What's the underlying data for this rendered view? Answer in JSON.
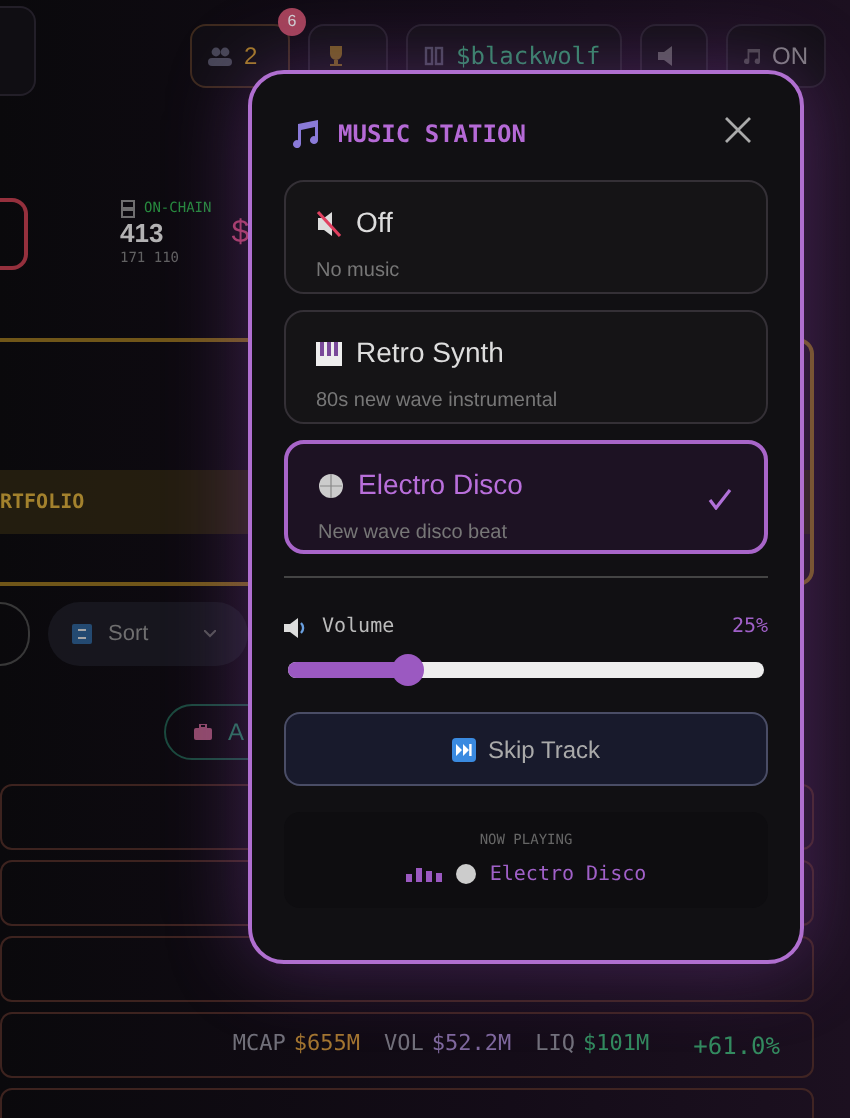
{
  "topbar": {
    "players_count": "2",
    "notification_badge": "6",
    "username": "$blackwolf",
    "music_toggle": "ON"
  },
  "stats": {
    "label": "ON-CHAIN",
    "value": "413",
    "sub": "171 110",
    "currency_symbol": "$"
  },
  "portfolio_banner": "RTFOLIO",
  "sort_select": "Sort",
  "add_button": "A",
  "token_rows": [
    {
      "fields": [
        {
          "label": "MCAP",
          "value": "$655M"
        },
        {
          "label": "VOL",
          "value": "$52.2M"
        },
        {
          "label": "LIQ",
          "value": "$101M"
        }
      ],
      "change": "+61.0%"
    }
  ],
  "modal": {
    "title": "MUSIC STATION",
    "stations": [
      {
        "kind": "off",
        "name": "Off",
        "description": "No music",
        "selected": false
      },
      {
        "kind": "synth",
        "name": "Retro Synth",
        "description": "80s new wave instrumental",
        "selected": false
      },
      {
        "kind": "disco",
        "name": "Electro Disco",
        "description": "New wave disco beat",
        "selected": true
      }
    ],
    "volume": {
      "label": "Volume",
      "reading": "25%",
      "level": 0.25
    },
    "skip_button": "Skip Track",
    "now_playing": {
      "label": "NOW PLAYING",
      "track": "Electro Disco"
    }
  }
}
